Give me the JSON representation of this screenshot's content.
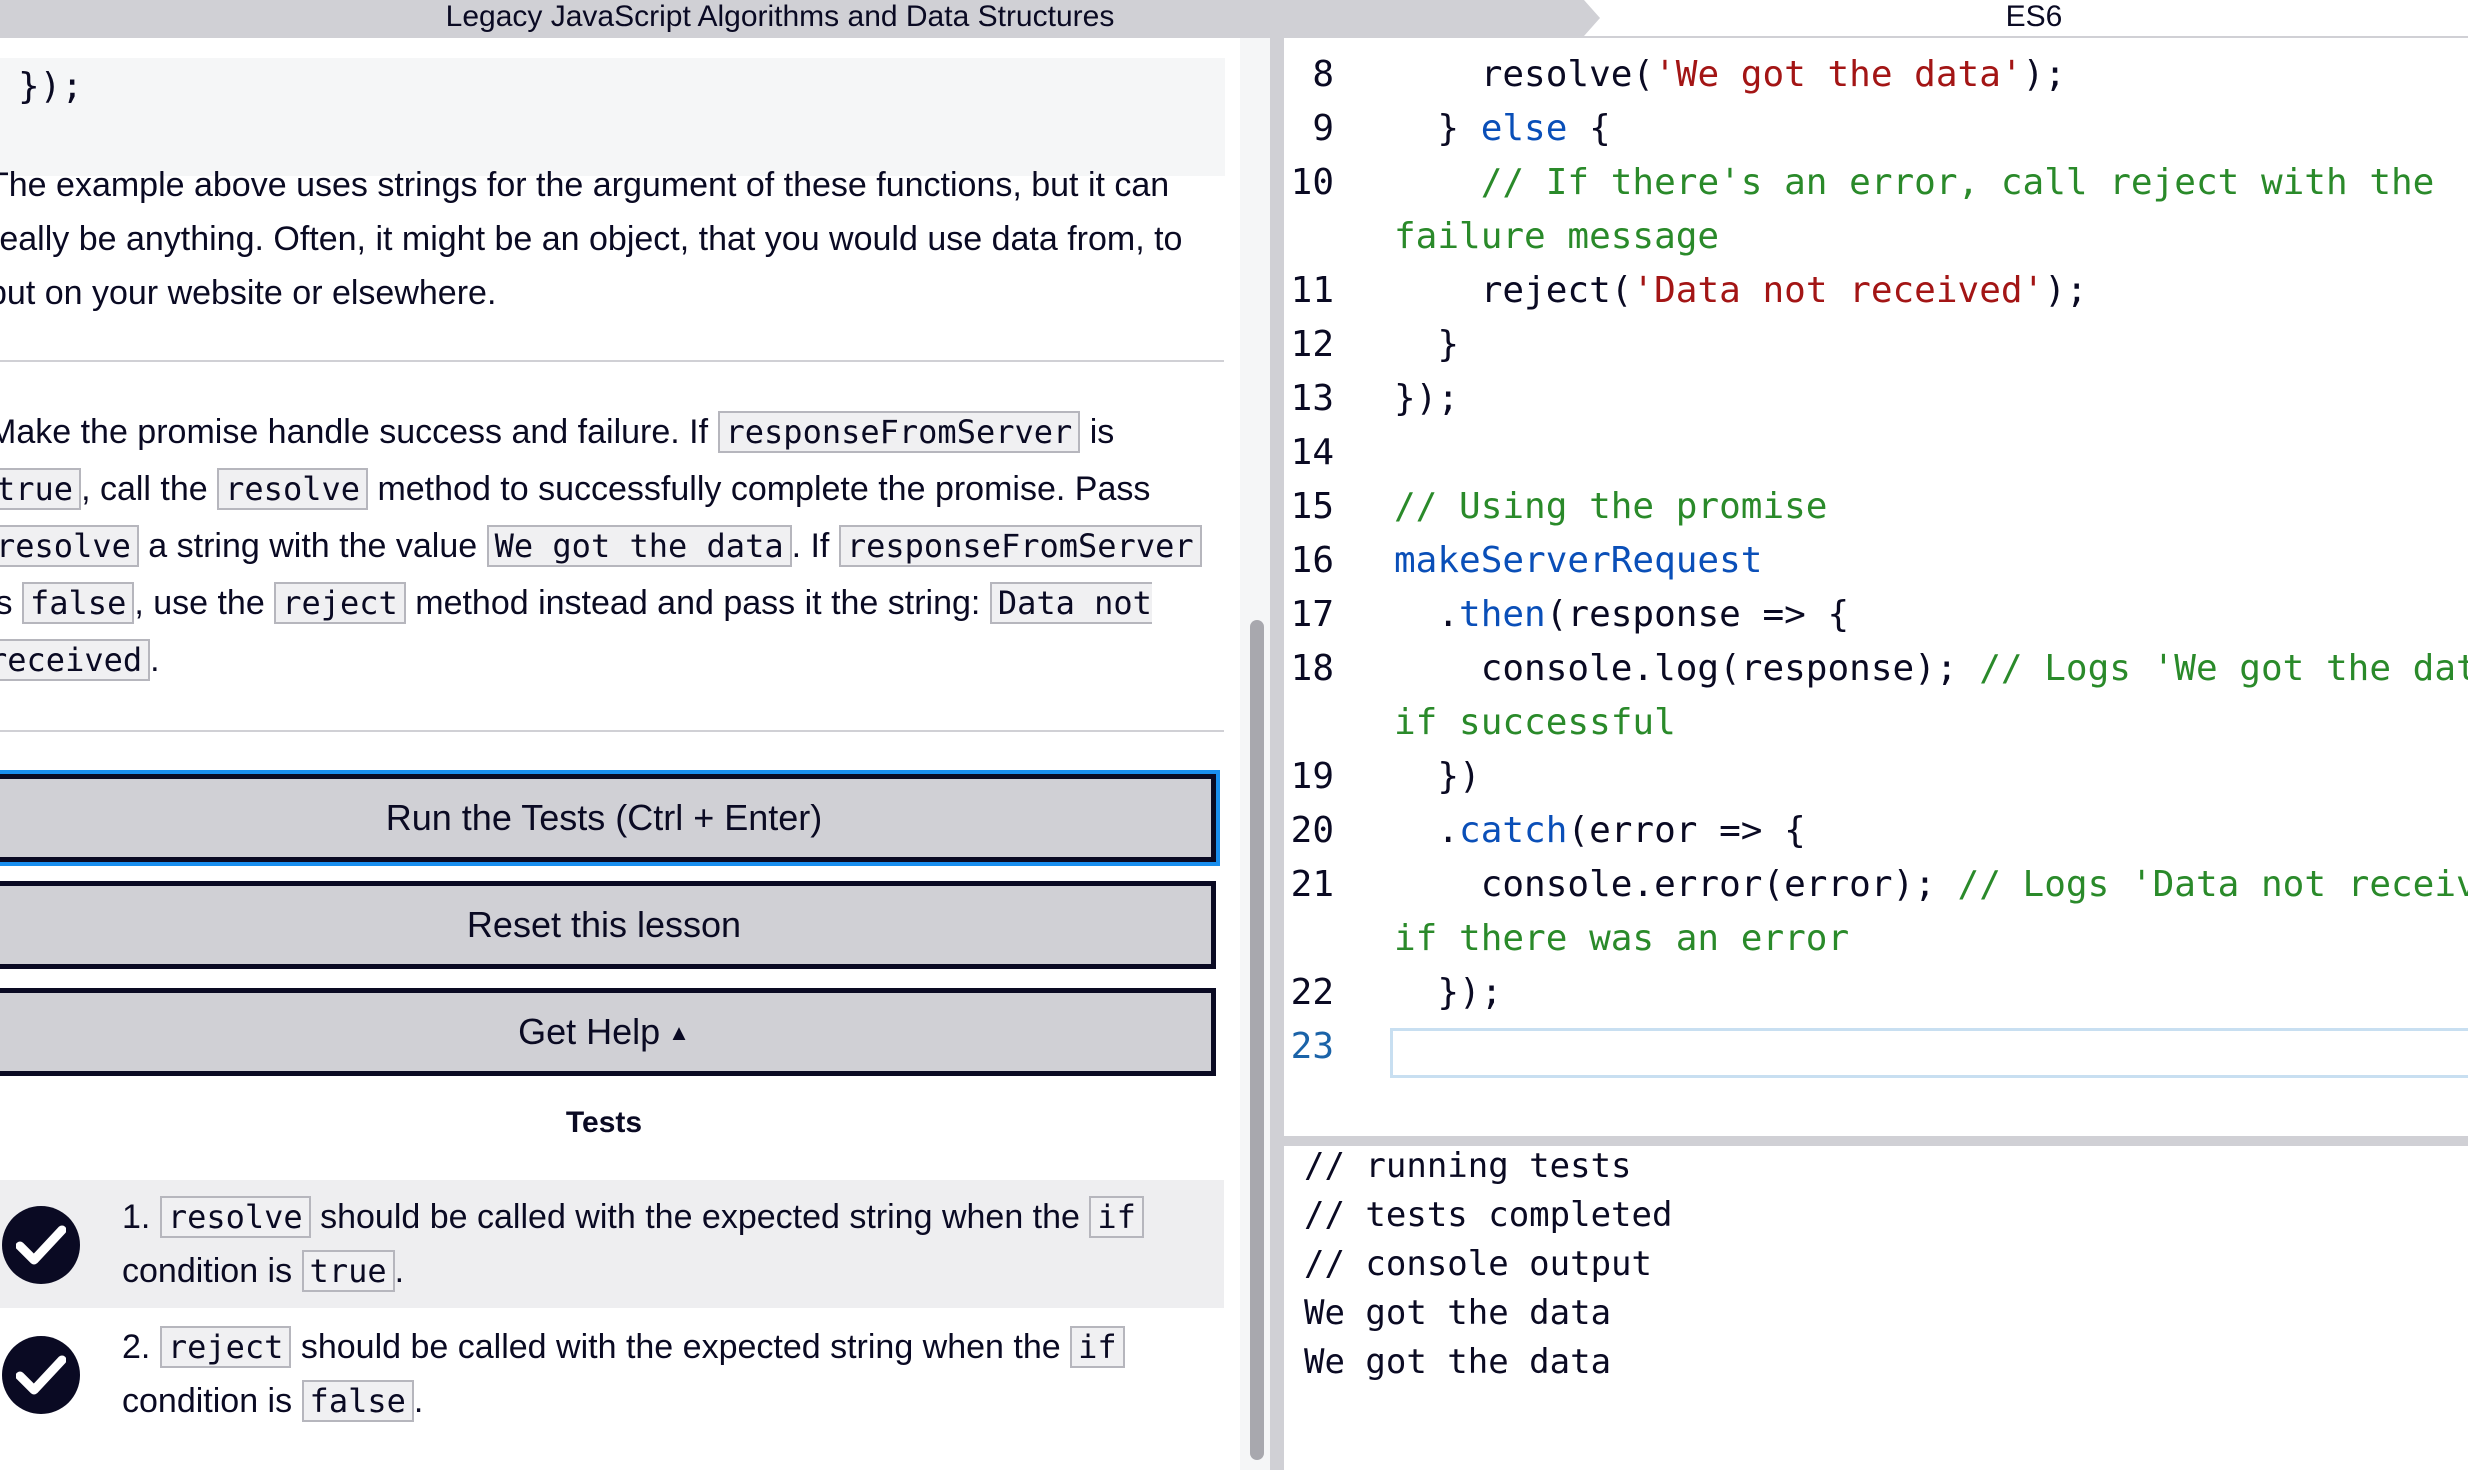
{
  "breadcrumb": {
    "course": "Legacy JavaScript Algorithms and Data Structures",
    "section": "ES6"
  },
  "instructions": {
    "code_tail": "});",
    "paragraph_1": "The example above uses strings for the argument of these functions, but it can really be anything. Often, it might be an object, that you would use data from, to put on your website or elsewhere.",
    "task": {
      "t1": "Make the promise handle success and failure. If ",
      "c1": "responseFromServer",
      "t2": " is ",
      "c2": "true",
      "t3": ", call the ",
      "c3": "resolve",
      "t4": " method to successfully complete the promise. Pass ",
      "c4": "resolve",
      "t5": " a string with the value ",
      "c5": "We got the data",
      "t6": ". If ",
      "c6": "responseFromServer",
      "t7": " is ",
      "c7": "false",
      "t8": ", use the ",
      "c8": "reject",
      "t9": " method instead and pass it the string: ",
      "c9": "Data not received",
      "t10": "."
    }
  },
  "buttons": {
    "run": "Run the Tests (Ctrl + Enter)",
    "reset": "Reset this lesson",
    "help": "Get Help"
  },
  "tests": {
    "title": "Tests",
    "items": [
      {
        "num": "1.",
        "code": "resolve",
        "text": " should be called with the expected string when the ",
        "code2": "if",
        "text2": " condition is ",
        "code3": "true",
        "end": ".",
        "passed": true
      },
      {
        "num": "2.",
        "code": "reject",
        "text": " should be called with the expected string when the ",
        "code2": "if",
        "text2": " condition is ",
        "code3": "false",
        "end": ".",
        "passed": true
      }
    ]
  },
  "editor": {
    "lines": {
      "l8": {
        "num": "8",
        "a": "    resolve(",
        "b": "'We got the data'",
        "c": ");"
      },
      "l9": {
        "num": "9",
        "a": "  } ",
        "b": "else",
        "c": " {"
      },
      "l10": {
        "num": "10",
        "a": "    ",
        "b": "// If there's an error, call reject with the",
        "wrap": "failure message"
      },
      "l11": {
        "num": "11",
        "a": "    reject(",
        "b": "'Data not received'",
        "c": ");"
      },
      "l12": {
        "num": "12",
        "a": "  }"
      },
      "l13": {
        "num": "13",
        "a": "});"
      },
      "l14": {
        "num": "14"
      },
      "l15": {
        "num": "15",
        "b": "// Using the promise"
      },
      "l16": {
        "num": "16",
        "a": "makeServerRequest"
      },
      "l17": {
        "num": "17",
        "a": "  .",
        "b": "then",
        "c": "(response => {"
      },
      "l18": {
        "num": "18",
        "a": "    console.log(response); ",
        "b": "// Logs 'We got the data'",
        "wrap": "if successful"
      },
      "l19": {
        "num": "19",
        "a": "  })"
      },
      "l20": {
        "num": "20",
        "a": "  .",
        "b": "catch",
        "c": "(error => {"
      },
      "l21": {
        "num": "21",
        "a": "    console.error(error); ",
        "b": "// Logs 'Data not received'",
        "wrap": "if there was an error"
      },
      "l22": {
        "num": "22",
        "a": "  });"
      },
      "l23": {
        "num": "23"
      }
    }
  },
  "console": {
    "lines": [
      "// running tests",
      "// tests completed",
      "// console output",
      "We got the data",
      "We got the data"
    ]
  },
  "colors": {
    "dark": "#0a0a23",
    "button_bg": "#d0d0d5",
    "focus_ring": "#198eee",
    "comment": "#2a8a2a",
    "string": "#a31515",
    "keyword": "#0a4fb8"
  }
}
